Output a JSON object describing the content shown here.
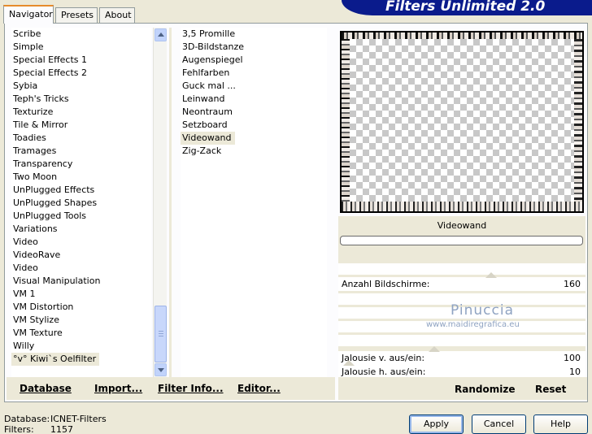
{
  "header": {
    "title": "Filters Unlimited 2.0"
  },
  "tabs": [
    "Navigator",
    "Presets",
    "About"
  ],
  "categories": [
    "Scribe",
    "Simple",
    "Special Effects 1",
    "Special Effects 2",
    "Sybia",
    "Teph's Tricks",
    "Texturize",
    "Tile & Mirror",
    "Toadies",
    "Tramages",
    "Transparency",
    "Two Moon",
    "UnPlugged Effects",
    "UnPlugged Shapes",
    "UnPlugged Tools",
    "Variations",
    "Video",
    "VideoRave",
    "Video",
    "Visual Manipulation",
    "VM 1",
    "VM Distortion",
    "VM Stylize",
    "VM Texture",
    "Willy",
    "°v° Kiwi`s Oelfilter"
  ],
  "filters": [
    "3,5 Promille",
    "3D-Bildstanze",
    "Augenspiegel",
    "Fehlfarben",
    "Guck mal ...",
    "Leinwand",
    "Neontraum",
    "Setzboard",
    "Videowand",
    "Zig-Zack"
  ],
  "selected_filter": "Videowand",
  "actions": {
    "database": "Database",
    "import": "Import...",
    "filter_info": "Filter Info...",
    "editor": "Editor..."
  },
  "params": [
    {
      "label": "Anzahl Bildschirme:",
      "value": "160"
    },
    {
      "label": "Jalousie v. aus/ein:",
      "value": "100"
    },
    {
      "label": "Jalousie h. aus/ein:",
      "value": "10"
    }
  ],
  "watermark": {
    "line1": "Pinuccia",
    "line2": "www.maidiregrafica.eu"
  },
  "buttons": {
    "randomize": "Randomize",
    "reset": "Reset",
    "apply": "Apply",
    "cancel": "Cancel",
    "help": "Help"
  },
  "status": {
    "database_label": "Database:",
    "database_value": "ICNET-Filters",
    "filters_label": "Filters:",
    "filters_value": "1157"
  }
}
